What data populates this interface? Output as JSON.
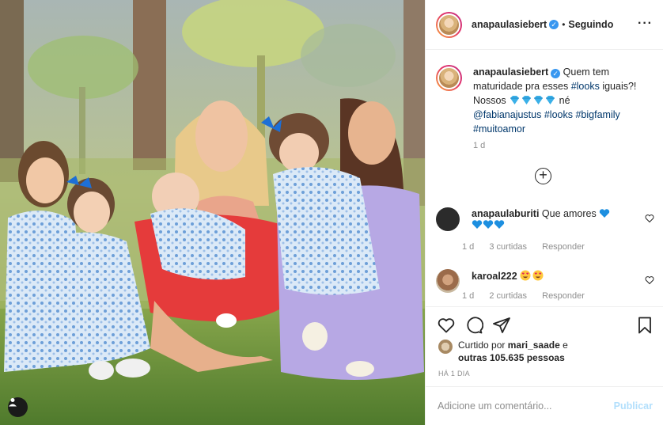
{
  "photo": {
    "description_icon": "user-tag-icon"
  },
  "header": {
    "username": "anapaulasiebert",
    "separator": "•",
    "follow_status": "Seguindo",
    "more_icon": "more-horizontal-icon"
  },
  "caption": {
    "username": "anapaulasiebert",
    "text_1": "Quem tem maturidade pra esses",
    "hashtag_1": "#looks",
    "text_2": "iguais?! Nossos",
    "text_3": "né",
    "mention": "@fabianajustus",
    "hashtag_2": "#looks",
    "hashtag_3": "#bigfamily",
    "hashtag_4": "#muitoamor",
    "age": "1 d"
  },
  "comments": [
    {
      "username": "anapaulaburiti",
      "text": "Que amores",
      "age": "1 d",
      "likes": "3 curtidas",
      "reply": "Responder",
      "avatar_color": "#2b2b2b"
    },
    {
      "username": "karoal222",
      "text": "",
      "age": "1 d",
      "likes": "2 curtidas",
      "reply": "Responder",
      "avatar_color": "#9b6b4a"
    }
  ],
  "likes": {
    "prefix": "Curtido por",
    "user": "mari_saade",
    "middle": "e",
    "others": "outras 105.635 pessoas"
  },
  "time_ago": "HÁ 1 DIA",
  "add_comment": {
    "placeholder": "Adicione um comentário...",
    "publish": "Publicar"
  },
  "colors": {
    "verified": "#3897f0",
    "link": "#00376b",
    "muted": "#8e8e8e",
    "publish_disabled": "#b2dffc",
    "heart_blue": "#1d8fe0"
  }
}
